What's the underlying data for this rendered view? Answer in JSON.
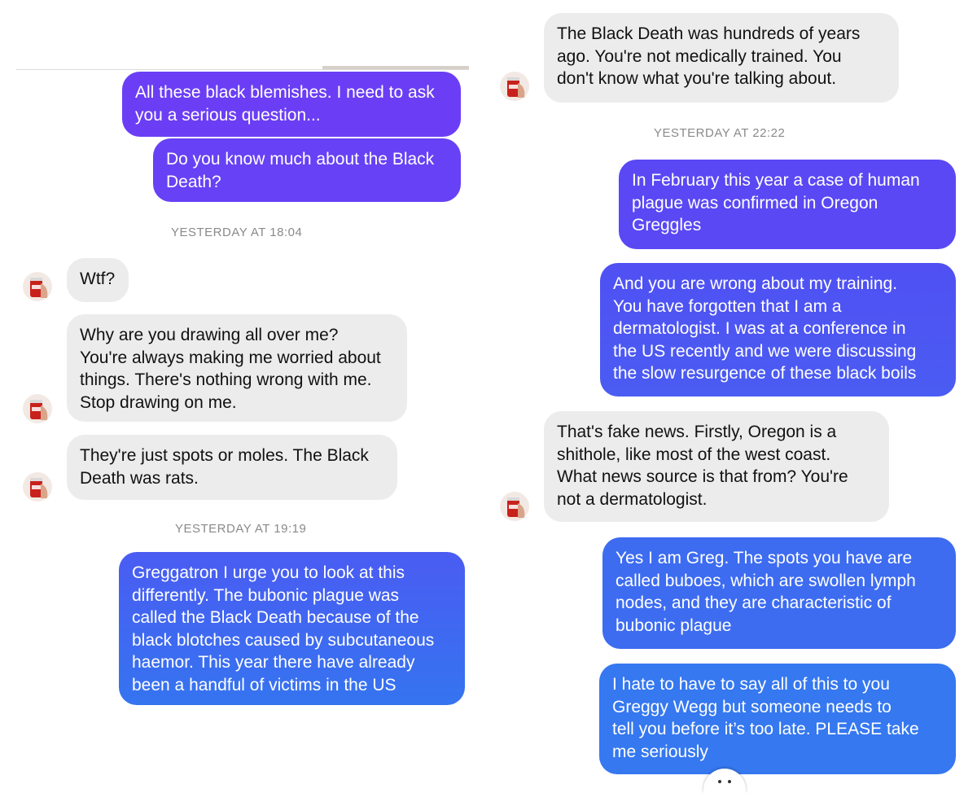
{
  "left": {
    "messages": [
      "All these black blemishes. I need to ask\nyou a serious question...",
      "Do you know much about the Black\nDeath?",
      "Wtf?",
      "Why are you drawing all over me?\nYou're always making me worried about\nthings. There's nothing wrong with me.\nStop drawing on me.",
      "They're just spots or moles. The Black\nDeath was rats.",
      "Greggatron I urge you to look at this\ndifferently. The bubonic plague was\ncalled the Black Death because of the\nblack blotches caused by subcutaneous\nhaemor. This year there have already\nbeen a handful of victims in the US"
    ],
    "timestamps": [
      "YESTERDAY AT 18:04",
      "YESTERDAY AT 19:19"
    ]
  },
  "right": {
    "messages": [
      "The Black Death was hundreds of years\nago. You're not medically trained. You\ndon't know what you're talking about.",
      "In February this year a case of human\nplague was confirmed in Oregon\nGreggles",
      "And you are wrong about my training.\nYou have forgotten that I am a\ndermatologist. I was at a conference in\nthe US recently and we were discussing\nthe slow resurgence of these black boils",
      "That's fake news. Firstly, Oregon is a\nshithole, like most of the west coast.\nWhat news source is that from? You're\nnot a dermatologist.",
      "Yes I am Greg. The spots you have are\ncalled buboes, which are swollen lymph\nnodes, and they are characteristic of\nbubonic plague",
      "I hate to have to say all of this to you\nGreggy Wegg but someone needs to\ntell you before it’s too late. PLEASE take\nme seriously"
    ],
    "timestamps": [
      "YESTERDAY AT 22:22"
    ]
  },
  "colors": {
    "outgoing_top": "#6a3ff5",
    "outgoing_mid": "#4f57f2",
    "outgoing_bottom": "#3377f0",
    "incoming": "#ececec",
    "timestamp": "#8a8a8a"
  },
  "icons": {
    "avatar": "soda-can-avatar-icon"
  }
}
